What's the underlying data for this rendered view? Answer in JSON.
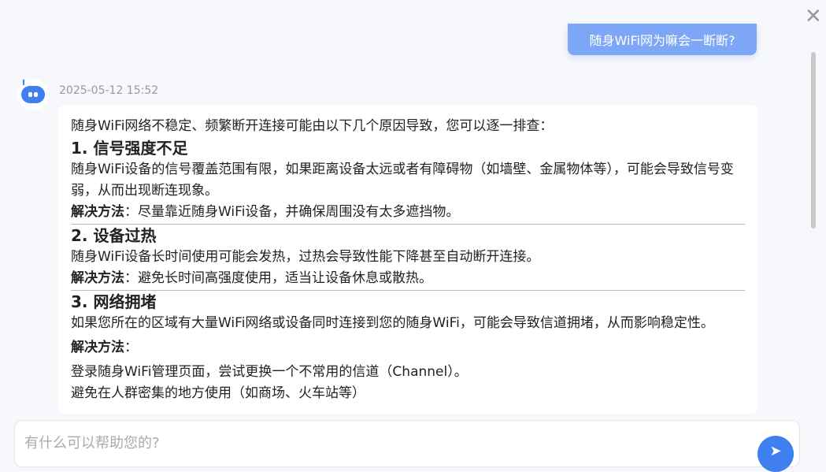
{
  "user_message": "随身WiFi网为嘛会一断断?",
  "timestamp": "2025-05-12 15:52",
  "answer": {
    "intro": "随身WiFi网络不稳定、频繁断开连接可能由以下几个原因导致，您可以逐一排查：",
    "sections": [
      {
        "title": "1. 信号强度不足",
        "body": "随身WiFi设备的信号覆盖范围有限，如果距离设备太远或者有障碍物（如墙壁、金属物体等），可能会导致信号变弱，从而出现断连现象。",
        "solution_label": "解决方法",
        "solution": "：尽量靠近随身WiFi设备，并确保周围没有太多遮挡物。"
      },
      {
        "title": "2. 设备过热",
        "body": "随身WiFi设备长时间使用可能会发热，过热会导致性能下降甚至自动断开连接。",
        "solution_label": "解决方法",
        "solution": "：避免长时间高强度使用，适当让设备休息或散热。"
      },
      {
        "title": "3. 网络拥堵",
        "body": "如果您所在的区域有大量WiFi网络或设备同时连接到您的随身WiFi，可能会导致信道拥堵，从而影响稳定性。",
        "solution_label": "解决方法",
        "solution": "：",
        "steps": [
          "登录随身WiFi管理页面，尝试更换一个不常用的信道（Channel）。",
          "避免在人群密集的地方使用（如商场、火车站等）"
        ]
      }
    ]
  },
  "input": {
    "placeholder": "有什么可以帮助您的?"
  },
  "colors": {
    "accent": "#3f7ff0",
    "user_bubble": "#7ea6f6"
  }
}
